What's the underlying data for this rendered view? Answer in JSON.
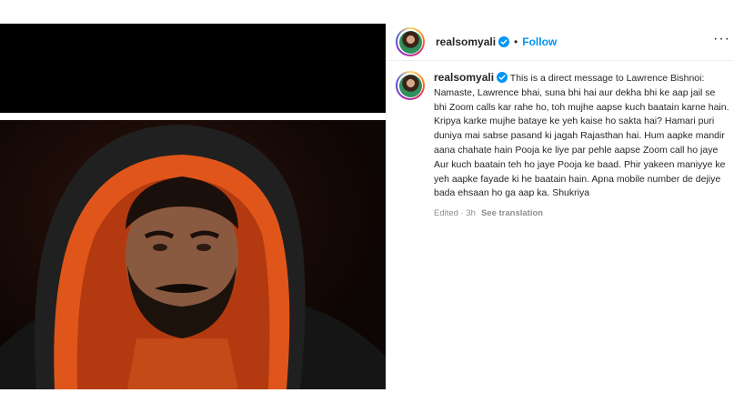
{
  "post": {
    "username": "realsomyali",
    "follow_label": "Follow",
    "separator": "•",
    "more_label": "···"
  },
  "caption": {
    "username": "realsomyali",
    "text": "This is a direct message to Lawrence Bishnoi: Namaste, Lawrence bhai, suna bhi hai aur dekha bhi ke aap jail se bhi Zoom calls kar rahe ho, toh mujhe aapse kuch baatain karne hain. Kripya karke mujhe bataye ke yeh kaise ho sakta hai? Hamari puri duniya mai sabse pasand ki jagah Rajasthan hai. Hum aapke mandir aana chahate hain Pooja ke liye par pehle aapse Zoom call ho jaye Aur kuch baatain teh ho jaye Pooja ke baad. Phir yakeen maniyye ke yeh aapke fayade ki he baatain hain. Apna mobile number de dejiye bada ehsaan ho ga aap ka. Shukriya",
    "edited": "Edited · 3h",
    "see_translation": "See translation"
  },
  "colors": {
    "accent": "#0095f6",
    "verified": "#0095f6",
    "meta_text": "#8e8e8e"
  },
  "icons": {
    "verified": "verified-badge-icon",
    "more": "more-options-icon"
  }
}
